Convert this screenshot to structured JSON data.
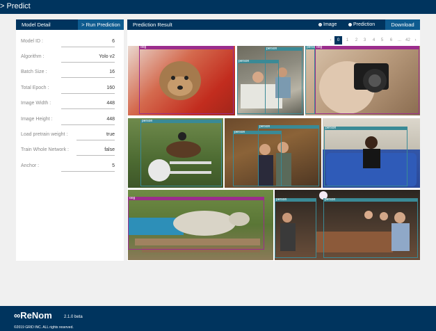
{
  "header": {
    "title": "> Predict"
  },
  "model_detail": {
    "title": "Model Detail",
    "run_button": "> Run Prediction",
    "params": [
      {
        "label": "Model ID :",
        "value": "6"
      },
      {
        "label": "Algorithm :",
        "value": "Yolo v2"
      },
      {
        "label": "Batch Size :",
        "value": "16"
      },
      {
        "label": "Total Epoch :",
        "value": "160"
      },
      {
        "label": "Image Width :",
        "value": "448"
      },
      {
        "label": "Image Height :",
        "value": "448"
      },
      {
        "label": "Load pretrain weight :",
        "value": "true"
      },
      {
        "label": "Train Whole Network :",
        "value": "false"
      },
      {
        "label": "Anchor :",
        "value": "5"
      }
    ]
  },
  "prediction_result": {
    "title": "Prediction Result",
    "radio_image": "Image",
    "radio_prediction": "Prediction",
    "selected": "Image",
    "download_button": "Download"
  },
  "pagination": {
    "prev": "‹",
    "next": "›",
    "pages": [
      "0",
      "1",
      "2",
      "3",
      "4",
      "5",
      "6",
      "...",
      "42"
    ],
    "current": "0"
  },
  "colors": {
    "person": "#3a8a96",
    "dog": "#9b2d8c",
    "navy": "#00345e",
    "accent": "#0e5b8f"
  },
  "images": [
    {
      "description": "dog photo",
      "labels": [
        "dog"
      ]
    },
    {
      "description": "hospital room",
      "labels": [
        "person",
        "person"
      ]
    },
    {
      "description": "person with camera",
      "labels": [
        "person",
        "dog"
      ]
    },
    {
      "description": "horse show jumping",
      "labels": [
        "person"
      ]
    },
    {
      "description": "people indoors",
      "labels": [
        "person",
        "person"
      ]
    },
    {
      "description": "woman on sofa",
      "labels": [
        "person"
      ]
    },
    {
      "description": "dog on wooden bench",
      "labels": [
        "dog"
      ]
    },
    {
      "description": "dinner table",
      "labels": [
        "person",
        "person"
      ]
    }
  ],
  "footer": {
    "logo": "∞ReNom",
    "version": "2.1.0 beta",
    "copyright": "©2019 GRID INC. ALL rights reserved."
  }
}
